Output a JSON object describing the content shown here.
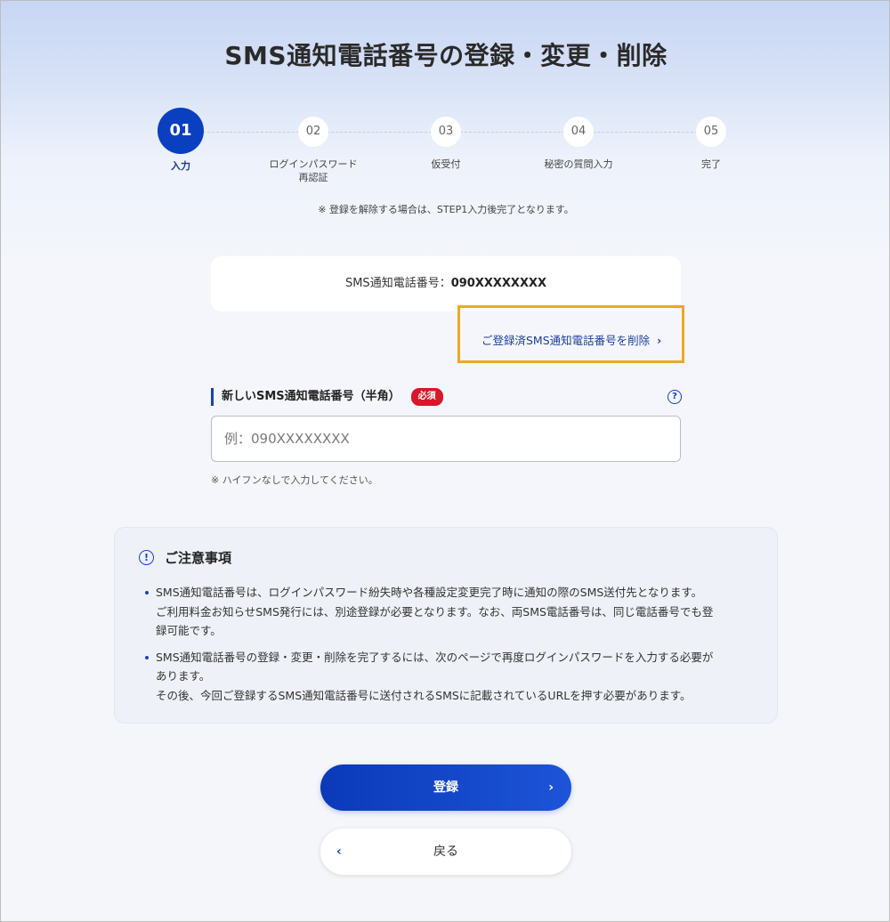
{
  "page": {
    "title": "SMS通知電話番号の登録・変更・削除"
  },
  "stepper": {
    "steps": [
      {
        "number": "01",
        "label": "入力",
        "active": true
      },
      {
        "number": "02",
        "label_line1": "ログインパスワード",
        "label_line2": "再認証",
        "active": false
      },
      {
        "number": "03",
        "label": "仮受付",
        "active": false
      },
      {
        "number": "04",
        "label": "秘密の質問入力",
        "active": false
      },
      {
        "number": "05",
        "label": "完了",
        "active": false
      }
    ],
    "note": "※ 登録を解除する場合は、STEP1入力後完了となります。"
  },
  "current": {
    "label": "SMS通知電話番号：",
    "value": "090XXXXXXXX"
  },
  "delete_link": {
    "label": "ご登録済SMS通知電話番号を削除",
    "chevron": "›"
  },
  "field": {
    "label": "新しいSMS通知電話番号（半角）",
    "required": "必須",
    "help_icon": "?",
    "placeholder": "例：090XXXXXXXX",
    "value": "",
    "note": "※ ハイフンなしで入力してください。"
  },
  "notice": {
    "icon": "!",
    "title": "ご注意事項",
    "items": [
      {
        "lines": [
          "SMS通知電話番号は、ログインパスワード紛失時や各種設定変更完了時に通知の際のSMS送付先となります。",
          "ご利用料金お知らせSMS発行には、別途登録が必要となります。なお、両SMS電話番号は、同じ電話番号でも登",
          "録可能です。"
        ]
      },
      {
        "lines": [
          "SMS通知電話番号の登録・変更・削除を完了するには、次のページで再度ログインパスワードを入力する必要が",
          "あります。",
          "その後、今回ご登録するSMS通知電話番号に送付されるSMSに記載されているURLを押す必要があります。"
        ]
      }
    ]
  },
  "buttons": {
    "register": "登録",
    "register_chevron": "›",
    "back": "戻る",
    "back_chevron": "‹"
  },
  "colors": {
    "primary": "#0a3fc0",
    "highlight_box": "#f0a723",
    "required": "#d7182a"
  }
}
